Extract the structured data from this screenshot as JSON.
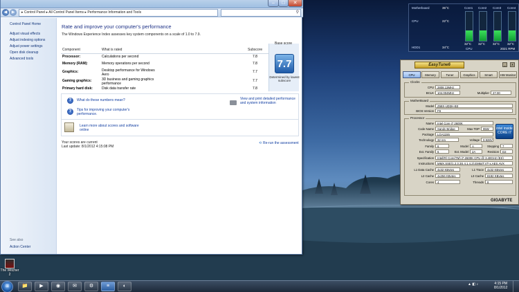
{
  "window": {
    "address": "▸ Control Panel ▸ All Control Panel Items ▸ Performance Information and Tools",
    "search_placeholder": "",
    "controls": {
      "minimize": "–",
      "maximize": "□",
      "close": "✕"
    }
  },
  "nav": {
    "home": "Control Panel Home",
    "links": [
      "Adjust visual effects",
      "Adjust indexing options",
      "Adjust power settings",
      "Open disk cleanup",
      "Advanced tools"
    ],
    "see_also": "See also",
    "action_center": "Action Center"
  },
  "main": {
    "title": "Rate and improve your computer's performance",
    "intro": "The Windows Experience Index assesses key system components on a scale of 1.0 to 7.9.",
    "headers": {
      "component": "Component",
      "what": "What is rated",
      "subscore": "Subscore",
      "base": "Base score"
    },
    "rows": [
      {
        "component": "Processor:",
        "what": "Calculations per second",
        "subscore": "7.8"
      },
      {
        "component": "Memory (RAM):",
        "what": "Memory operations per second",
        "subscore": "7.8"
      },
      {
        "component": "Graphics:",
        "what": "Desktop performance for Windows Aero",
        "subscore": "7.7"
      },
      {
        "component": "Gaming graphics:",
        "what": "3D business and gaming graphics performance",
        "subscore": "7.7"
      },
      {
        "component": "Primary hard disk:",
        "what": "Disk data transfer rate",
        "subscore": "7.8"
      }
    ],
    "base_score": "7.7",
    "base_note": "Determined by lowest subscore",
    "help": {
      "what_mean": "What do these numbers mean?",
      "tips": "Tips for improving your computer's performance.",
      "view_print": "View and print detailed performance and system information",
      "more_online": "Learn more about scores and software online"
    },
    "status_current": "Your scores are current",
    "last_update": "Last update: 8/1/2012 4:15:08 PM",
    "rerun": "Re-run the assessment"
  },
  "desktop": {
    "icon_label": "The Witcher 2"
  },
  "gadget": {
    "labels": {
      "motherboard": "Motherboard",
      "cpu": "CPU",
      "hdd": "HDD1",
      "cpu_bottom": "CPU"
    },
    "temps": {
      "motherboard": "35°C",
      "cpu": "22°C",
      "hdd": "34°C"
    },
    "cores": [
      "Core1",
      "Core2",
      "Core3",
      "Core4"
    ],
    "core_temps": [
      "32°C",
      "32°C",
      "32°C",
      "32°C"
    ],
    "core_levels": [
      0.35,
      0.35,
      0.35,
      0.35
    ],
    "rpm": "2021 RPM"
  },
  "easytune": {
    "logo": "EasyTune6",
    "tabs": [
      "CPU",
      "Memory",
      "Tuner",
      "Graphics",
      "Smart",
      "HW Monitor"
    ],
    "clocks": {
      "title": "Clocks",
      "cpu_label": "CPU",
      "cpu_value": "2808.13MHz",
      "bclk_label": "BCLK",
      "bclk_value": "104.004MHz",
      "mult_label": "Multiplier",
      "mult_value": "27.00"
    },
    "motherboard": {
      "title": "MotherBoard",
      "model_label": "Model",
      "model_value": "Z68X-UD3H-B3",
      "bios_label": "BIOS Version",
      "bios_value": "F9"
    },
    "processor": {
      "title": "Processor",
      "fields": [
        {
          "label": "Name",
          "value": "Intel Core i7 2600K"
        },
        {
          "label": "Code Name",
          "value": "Sandy Bridge"
        },
        {
          "label": "Max TDP",
          "value": "95W"
        },
        {
          "label": "Package",
          "value": "LGA1155"
        },
        {
          "label": "Technology",
          "value": "32 nm"
        },
        {
          "label": "Voltage",
          "value": "0.928V"
        },
        {
          "label": "Family",
          "value": "6"
        },
        {
          "label": "Model",
          "value": "A"
        },
        {
          "label": "Stepping",
          "value": "7"
        },
        {
          "label": "Ext. Family",
          "value": "6"
        },
        {
          "label": "Ext. Model",
          "value": "2A"
        },
        {
          "label": "Revision",
          "value": "D2"
        },
        {
          "label": "Specification",
          "value": "Intel(R) Core(TM) i7-2600K CPU @ 3.40GHz (ES)"
        },
        {
          "label": "Instructions",
          "value": "MMX,SSE(1,2,3,3S,4.1,4.2),EM64T,VT-x,AES,AVX"
        },
        {
          "label": "L1 Data Cache",
          "value": "4x32 KBytes"
        },
        {
          "label": "L1 Trace",
          "value": "4x32 KBytes"
        },
        {
          "label": "L2 Cache",
          "value": "4x256 KBytes"
        },
        {
          "label": "L3 Cache",
          "value": "8192 KBytes"
        },
        {
          "label": "Cores",
          "value": "4"
        },
        {
          "label": "Threads",
          "value": "8"
        }
      ],
      "intel_logo": "intel inside CORE i7"
    },
    "brand": "GIGABYTE"
  },
  "taskbar": {
    "start": "⊞",
    "items": [
      "📁",
      "▶",
      "◉",
      "✉",
      "⚙",
      "≡",
      "◐"
    ],
    "time": "4:15 PM",
    "date": "8/1/2012"
  }
}
